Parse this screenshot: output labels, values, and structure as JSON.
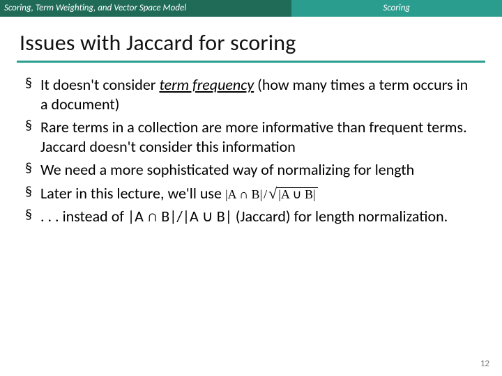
{
  "header": {
    "left": "Scoring, Term Weighting, and Vector Space Model",
    "right": "Scoring"
  },
  "title": "Issues with Jaccard for scoring",
  "bullets": [
    {
      "pre": "It doesn't consider ",
      "em1": "term frequency",
      "post": " (how many times a term occurs in a document)"
    },
    {
      "pre": "Rare terms in a collection are more informative than frequent terms. Jaccard doesn't consider this information"
    },
    {
      "pre": "We need a more sophisticated way of normalizing for length"
    },
    {
      "pre": "Later in this lecture, we'll use  ",
      "formula": true
    },
    {
      "pre": ". . . instead of |A ∩ B|/|A ∪ B| (Jaccard) for length normalization."
    }
  ],
  "formula": {
    "numer": "|A ∩ B|",
    "sep": "/",
    "rad": "√",
    "denom": "|A ∪ B|"
  },
  "pagenum": "12"
}
